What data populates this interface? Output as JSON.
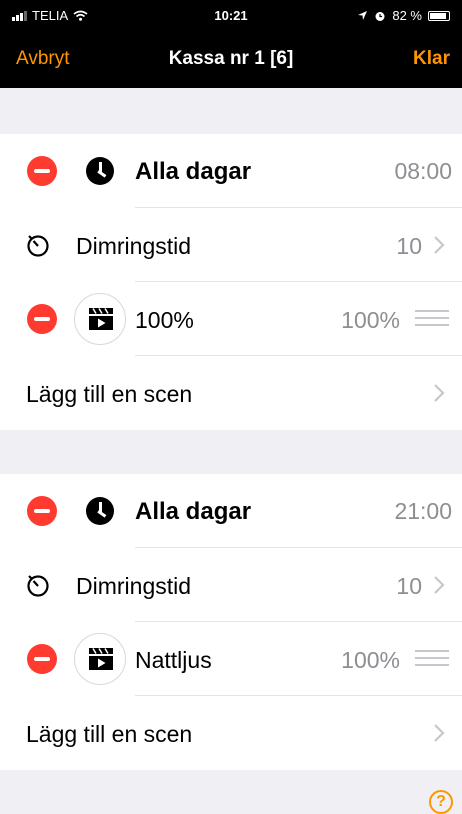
{
  "status_bar": {
    "carrier": "TELIA",
    "time": "10:21",
    "battery": "82 %",
    "battery_level": 0.82
  },
  "navbar": {
    "cancel": "Avbryt",
    "title": "Kassa nr 1 [6]",
    "done": "Klar"
  },
  "schedules": [
    {
      "title": "Alla dagar",
      "time": "08:00",
      "dim_label": "Dimringstid",
      "dim_value": "10",
      "scene": {
        "name": "100%",
        "level": "100%"
      },
      "add_scene": "Lägg till en scen"
    },
    {
      "title": "Alla dagar",
      "time": "21:00",
      "dim_label": "Dimringstid",
      "dim_value": "10",
      "scene": {
        "name": "Nattljus",
        "level": "100%"
      },
      "add_scene": "Lägg till en scen"
    }
  ],
  "help": "?",
  "colors": {
    "accent": "#ff9500",
    "delete": "#ff3b30",
    "secondary_text": "#8e8e93",
    "background": "#efeff4"
  },
  "icons": [
    "signal-icon",
    "wifi-icon",
    "location-icon",
    "alarm-icon",
    "battery-icon",
    "clock-icon",
    "timer-icon",
    "scene-icon",
    "reorder-icon",
    "chevron-right-icon",
    "help-icon"
  ]
}
